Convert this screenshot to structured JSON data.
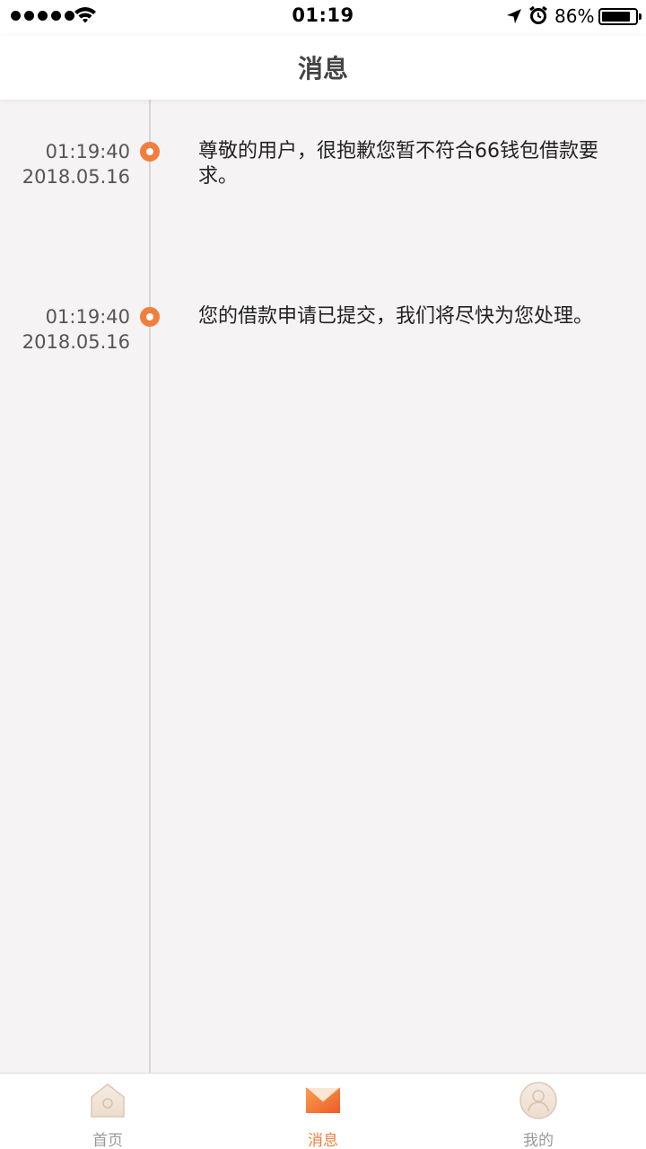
{
  "status_bar": {
    "time": "01:19",
    "battery": "86%",
    "battery_level": 0.86
  },
  "header": {
    "title": "消息"
  },
  "messages": [
    {
      "time": "01:19:40",
      "date": "2018.05.16",
      "text": "尊敬的用户，很抱歉您暂不符合66钱包借款要求。"
    },
    {
      "time": "01:19:40",
      "date": "2018.05.16",
      "text": "您的借款申请已提交，我们将尽快为您处理。"
    }
  ],
  "tabs": [
    {
      "label": "首页",
      "icon": "home-icon",
      "active": false
    },
    {
      "label": "消息",
      "icon": "envelope-icon",
      "active": true
    },
    {
      "label": "我的",
      "icon": "profile-icon",
      "active": false
    }
  ],
  "colors": {
    "accent": "#f07f3c",
    "background": "#f5f3f4",
    "inactive_tab": "#999999"
  }
}
